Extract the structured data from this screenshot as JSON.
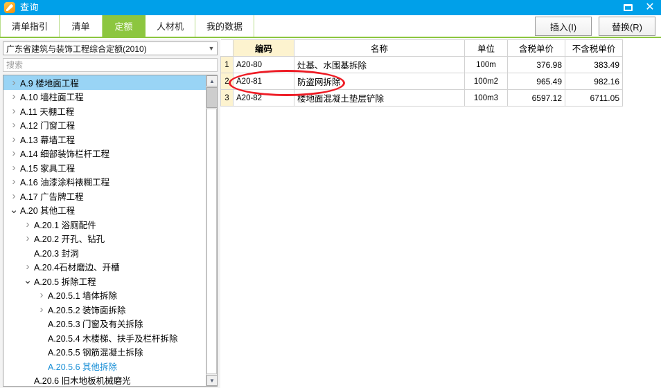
{
  "window": {
    "title": "查询",
    "app_icon": "edit-pen-icon",
    "restore_icon": "restore-window-icon",
    "close_icon": "close-window-icon",
    "titlebar_color": "#00a0e9"
  },
  "tabs": {
    "active": "定额",
    "accent_color": "#8cc63f",
    "items": [
      {
        "label": "清单指引"
      },
      {
        "label": "清单"
      },
      {
        "label": "定额"
      },
      {
        "label": "人材机"
      },
      {
        "label": "我的数据"
      }
    ]
  },
  "toolbar": {
    "insert_label": "插入(I)",
    "replace_label": "替换(R)"
  },
  "sidebar": {
    "dictionary": {
      "value": "广东省建筑与装饰工程综合定额(2010)",
      "caret_icon": "chevron-down-icon"
    },
    "search": {
      "placeholder": "搜索",
      "value": ""
    },
    "scrollbar": {
      "up_icon": "scroll-up-arrow-icon",
      "down_icon": "scroll-down-arrow-icon"
    },
    "tree": [
      {
        "label": "A.9  楼地面工程",
        "indent": 0,
        "twisty": "collapsed",
        "state": "selected"
      },
      {
        "label": "A.10  墙柱面工程",
        "indent": 0,
        "twisty": "collapsed",
        "state": "normal"
      },
      {
        "label": "A.11  天棚工程",
        "indent": 0,
        "twisty": "collapsed",
        "state": "normal"
      },
      {
        "label": "A.12  门窗工程",
        "indent": 0,
        "twisty": "collapsed",
        "state": "normal"
      },
      {
        "label": "A.13  幕墙工程",
        "indent": 0,
        "twisty": "collapsed",
        "state": "normal"
      },
      {
        "label": "A.14  细部装饰栏杆工程",
        "indent": 0,
        "twisty": "collapsed",
        "state": "normal"
      },
      {
        "label": "A.15  家具工程",
        "indent": 0,
        "twisty": "collapsed",
        "state": "normal"
      },
      {
        "label": "A.16  油漆涂料裱糊工程",
        "indent": 0,
        "twisty": "collapsed",
        "state": "normal"
      },
      {
        "label": "A.17  广告牌工程",
        "indent": 0,
        "twisty": "collapsed",
        "state": "normal"
      },
      {
        "label": "A.20  其他工程",
        "indent": 0,
        "twisty": "expanded",
        "state": "normal"
      },
      {
        "label": "A.20.1  浴厕配件",
        "indent": 1,
        "twisty": "collapsed",
        "state": "normal"
      },
      {
        "label": "A.20.2  开孔、钻孔",
        "indent": 1,
        "twisty": "collapsed",
        "state": "normal"
      },
      {
        "label": "A.20.3  封洞",
        "indent": 1,
        "twisty": "leaf",
        "state": "normal"
      },
      {
        "label": "A.20.4石材磨边、开槽",
        "indent": 1,
        "twisty": "collapsed",
        "state": "normal"
      },
      {
        "label": "A.20.5  拆除工程",
        "indent": 1,
        "twisty": "expanded",
        "state": "normal"
      },
      {
        "label": "A.20.5.1  墙体拆除",
        "indent": 2,
        "twisty": "collapsed",
        "state": "normal"
      },
      {
        "label": "A.20.5.2  装饰面拆除",
        "indent": 2,
        "twisty": "collapsed",
        "state": "normal"
      },
      {
        "label": "A.20.5.3  门窗及有关拆除",
        "indent": 2,
        "twisty": "leaf",
        "state": "normal"
      },
      {
        "label": "A.20.5.4  木楼梯、扶手及栏杆拆除",
        "indent": 2,
        "twisty": "leaf",
        "state": "normal"
      },
      {
        "label": "A.20.5.5  钢筋混凝土拆除",
        "indent": 2,
        "twisty": "leaf",
        "state": "normal"
      },
      {
        "label": "A.20.5.6  其他拆除",
        "indent": 2,
        "twisty": "leaf",
        "state": "active"
      },
      {
        "label": "A.20.6  旧木地板机械磨光",
        "indent": 1,
        "twisty": "leaf",
        "state": "normal"
      }
    ]
  },
  "table": {
    "sorted_column": "编码",
    "columns": [
      {
        "key": "rownum",
        "label": ""
      },
      {
        "key": "code",
        "label": "编码"
      },
      {
        "key": "name",
        "label": "名称"
      },
      {
        "key": "unit",
        "label": "单位"
      },
      {
        "key": "price_with_tax",
        "label": "含税单价"
      },
      {
        "key": "price_without_tax",
        "label": "不含税单价"
      }
    ],
    "rows": [
      {
        "rownum": "1",
        "code": "A20-80",
        "name": "灶基、水围基拆除",
        "unit": "100m",
        "price_with_tax": "376.98",
        "price_without_tax": "383.49",
        "selected_cell": true
      },
      {
        "rownum": "2",
        "code": "A20-81",
        "name": "防盗网拆除",
        "unit": "100m2",
        "price_with_tax": "965.49",
        "price_without_tax": "982.16",
        "selected_cell": false
      },
      {
        "rownum": "3",
        "code": "A20-82",
        "name": "楼地面混凝土垫层铲除",
        "unit": "100m3",
        "price_with_tax": "6597.12",
        "price_without_tax": "6711.05",
        "selected_cell": false
      }
    ]
  },
  "annotation": {
    "shape": "red-ellipse-highlight",
    "color": "#ee1c25",
    "target_row": "2"
  }
}
